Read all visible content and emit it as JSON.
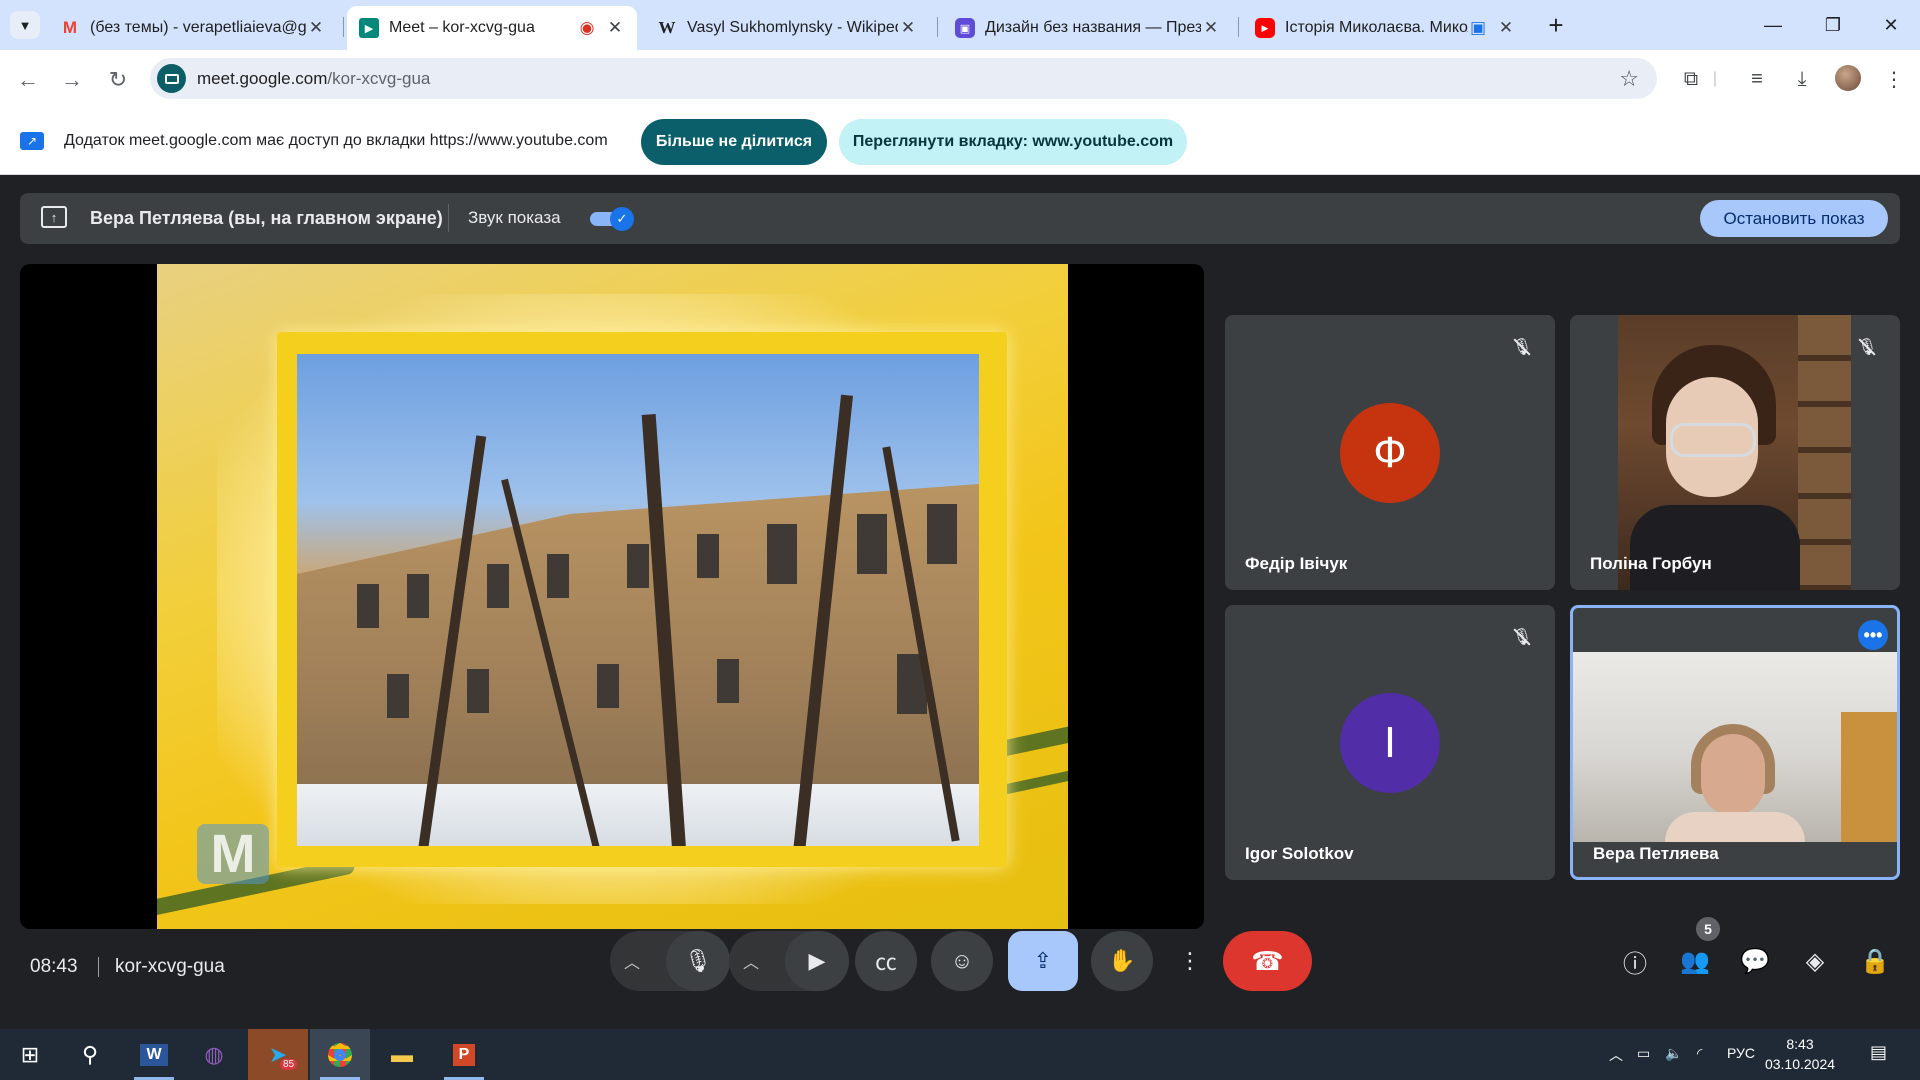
{
  "browser": {
    "tabs": [
      {
        "title": "(без темы) - verapetliaieva@gn",
        "favicon": "gmail-icon",
        "active": false
      },
      {
        "title": "Meet – kor-xcvg-gua",
        "favicon": "meet-icon",
        "active": true
      },
      {
        "title": "Vasyl Sukhomlynsky - Wikipedi",
        "favicon": "wikipedia-icon",
        "active": false
      },
      {
        "title": "Дизайн без названия — Презе",
        "favicon": "canva-icon",
        "active": false
      },
      {
        "title": "Історія Миколаєва. Микол",
        "favicon": "youtube-icon",
        "active": false
      }
    ],
    "new_tab_label": "+",
    "url_host": "meet.google.com",
    "url_path": "/kor-xcvg-gua"
  },
  "infobar": {
    "text": "Додаток meet.google.com має доступ до вкладки https://www.youtube.com",
    "stop_sharing_label": "Більше не ділитися",
    "view_tab_label": "Переглянути вкладку: www.youtube.com"
  },
  "presenting": {
    "name_label": "Вера Петляева (вы, на главном экране)",
    "audio_label": "Звук показа",
    "audio_on": true,
    "stop_label": "Остановить показ"
  },
  "slide": {
    "logo_letter": "M"
  },
  "participants": [
    {
      "name": "Федір Івічук",
      "initial": "Ф",
      "color": "#c5340f",
      "muted": true
    },
    {
      "name": "Поліна Горбун",
      "initial": "",
      "video": true,
      "muted": true
    },
    {
      "name": "Igor Solotkov",
      "initial": "I",
      "color": "#512da8",
      "muted": true
    },
    {
      "name": "Вера Петляева",
      "initial": "",
      "video": true,
      "self": true
    }
  ],
  "controls": {
    "time": "08:43",
    "meeting_code": "kor-xcvg-gua",
    "participant_count": "5"
  },
  "taskbar": {
    "language": "РУС",
    "time": "8:43",
    "date": "03.10.2024",
    "telegram_badge": "85"
  },
  "colors": {
    "meet_bg": "#202124",
    "accent_blue": "#a8c7fa",
    "hangup_red": "#dc362e",
    "infobar_teal": "#0b5f6b"
  }
}
